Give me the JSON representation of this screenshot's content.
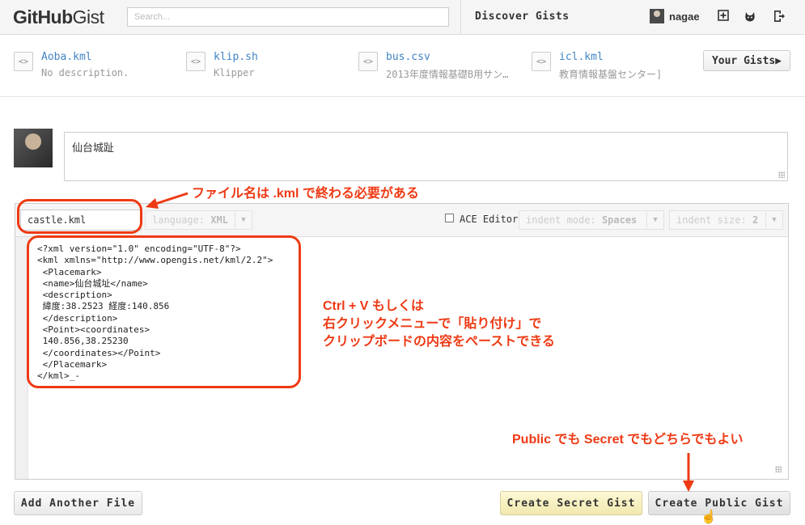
{
  "header": {
    "logo_bold": "GitHub",
    "logo_light": "Gist",
    "search_placeholder": "Search...",
    "discover": "Discover Gists",
    "username": "nagae"
  },
  "recent_gists": [
    {
      "name": "Aoba.kml",
      "desc": "No description."
    },
    {
      "name": "klip.sh",
      "desc": "Klipper"
    },
    {
      "name": "bus.csv",
      "desc": "2013年度情報基礎B用サン…"
    },
    {
      "name": "icl.kml",
      "desc": "教育情報基盤センター]"
    }
  ],
  "your_gists": "Your Gists",
  "description": "仙台城趾",
  "file": {
    "name": "castle.kml",
    "language_label": "language:",
    "language": "XML",
    "ace_label": "ACE Editor",
    "indent_mode_label": "indent mode:",
    "indent_mode": "Spaces",
    "indent_size_label": "indent size:",
    "indent_size": "2"
  },
  "code_lines": [
    "<?xml version=\"1.0\" encoding=\"UTF-8\"?>",
    "<kml xmlns=\"http://www.opengis.net/kml/2.2\">",
    " <Placemark>",
    " <name>仙台城址</name>",
    " <description>",
    " 緯度:38.2523 経度:140.856",
    " </description>",
    " <Point><coordinates>",
    " 140.856,38.25230",
    " </coordinates></Point>",
    " </Placemark>",
    "</kml>_-"
  ],
  "buttons": {
    "add_file": "Add Another File",
    "secret": "Create Secret Gist",
    "public": "Create Public Gist"
  },
  "annotations": {
    "filename_note": "ファイル名は .kml で終わる必要がある",
    "paste_line1": "Ctrl + V もしくは",
    "paste_line2": "右クリックメニューで「貼り付け」で",
    "paste_line3": "クリップボードの内容をペーストできる",
    "public_note": "Public でも Secret でもどちらでもよい"
  },
  "colors": {
    "annotation": "#ee3a14",
    "link": "#4183c4",
    "secret_button": "#f6efc0"
  }
}
